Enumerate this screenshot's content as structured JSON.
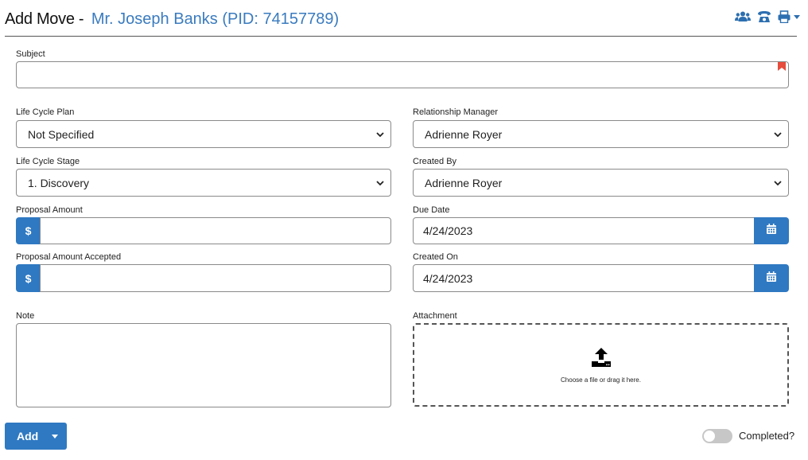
{
  "header": {
    "title": "Add Move -",
    "person": "Mr. Joseph Banks (PID: 74157789)",
    "icons": [
      "users-icon",
      "phone-icon",
      "print-icon",
      "dropdown-caret-icon"
    ]
  },
  "form": {
    "subject": {
      "label": "Subject",
      "value": ""
    },
    "life_cycle_plan": {
      "label": "Life Cycle Plan",
      "value": "Not Specified"
    },
    "relationship_manager": {
      "label": "Relationship Manager",
      "value": "Adrienne Royer"
    },
    "life_cycle_stage": {
      "label": "Life Cycle Stage",
      "value": "1. Discovery"
    },
    "created_by": {
      "label": "Created By",
      "value": "Adrienne Royer"
    },
    "proposal_amount": {
      "label": "Proposal Amount",
      "prefix": "$",
      "value": ""
    },
    "due_date": {
      "label": "Due Date",
      "value": "4/24/2023"
    },
    "proposal_amount_accepted": {
      "label": "Proposal Amount Accepted",
      "prefix": "$",
      "value": ""
    },
    "created_on": {
      "label": "Created On",
      "value": "4/24/2023"
    },
    "note": {
      "label": "Note",
      "value": ""
    },
    "attachment": {
      "label": "Attachment",
      "hint": "Choose a file or drag it here."
    }
  },
  "footer": {
    "add_label": "Add",
    "completed_label": "Completed?",
    "completed": false
  },
  "colors": {
    "accent": "#2f79c2",
    "title_link": "#3a7bbf",
    "required_flag": "#e74c3c"
  }
}
